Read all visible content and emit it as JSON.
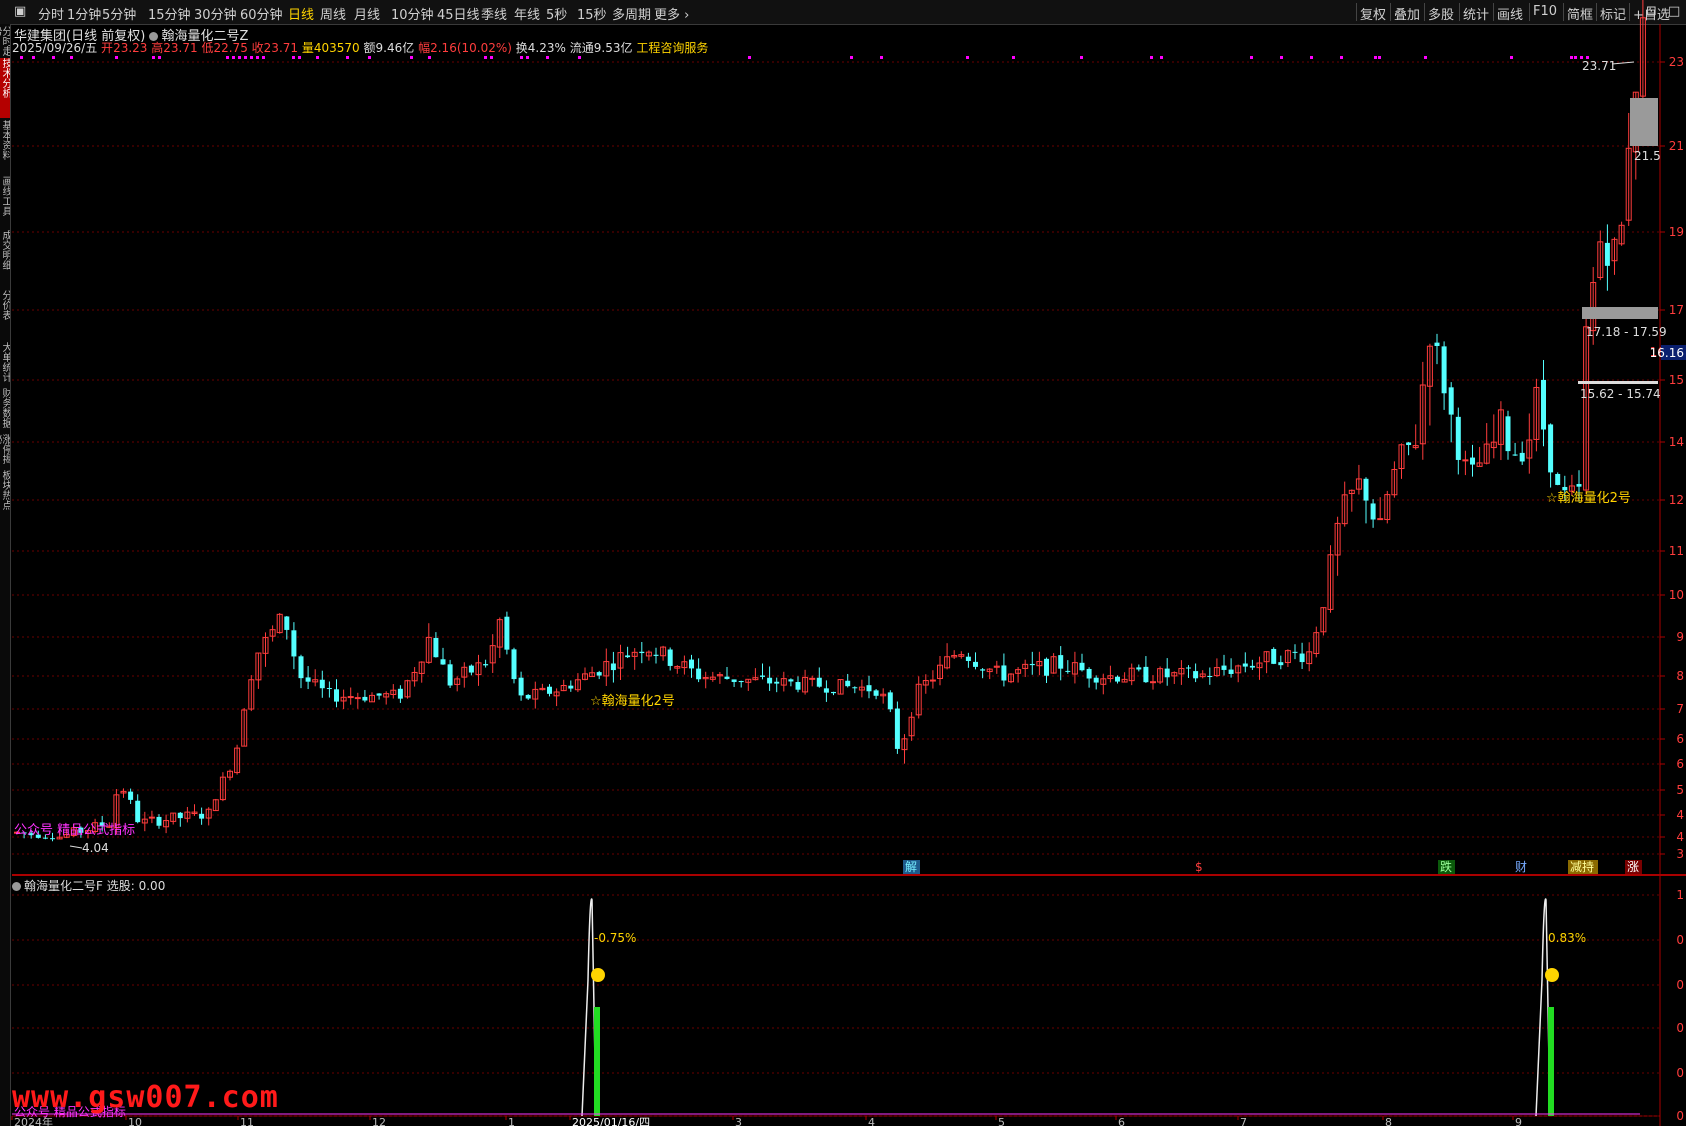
{
  "toolbar": {
    "period_tabs": [
      "分时",
      "1分钟",
      "5分钟",
      "15分钟",
      "30分钟",
      "60分钟",
      "日线",
      "周线",
      "月线",
      "10分钟",
      "45日线",
      "季线",
      "年线",
      "5秒",
      "15秒",
      "多周期",
      "更多"
    ],
    "active_period": "日线",
    "right_buttons": [
      "复权",
      "叠加",
      "多股",
      "统计",
      "画线",
      "F10",
      "简框",
      "标记",
      "+自选"
    ]
  },
  "sidebar": {
    "tabs": [
      "分时走势",
      "技术分析",
      "基本资料",
      "画线工具",
      "成交明细",
      "分价表",
      "大单统计",
      "财务数据",
      "涨停揭秘",
      "板块热点"
    ],
    "active_index": 1
  },
  "header": {
    "stock_name": "华建集团",
    "period_info": "(日线 前复权)",
    "indicator_name": "翰海量化二号Z",
    "date": "2025/09/26/五",
    "open_label": "开",
    "open": "23.23",
    "high_label": "高",
    "high": "23.71",
    "low_label": "低",
    "low": "22.75",
    "close_label": "收",
    "close": "23.71",
    "volume_label": "量",
    "volume": "403570",
    "amount_label": "额",
    "amount": "9.46亿",
    "change_label": "幅",
    "change": "2.16(10.02%)",
    "turnover_label": "换",
    "turnover": "4.23%",
    "float_label": "流通",
    "float": "9.53亿",
    "industry": "工程咨询服务"
  },
  "main_chart": {
    "price_axis": [
      "23",
      "21",
      "19",
      "17",
      "16.16",
      "15",
      "14",
      "12",
      "11",
      "10",
      "9",
      "8",
      "7",
      "6",
      "6",
      "5",
      "4",
      "4",
      "3"
    ],
    "current_price_tag": "16.16",
    "high_marker": "23.71",
    "low_marker": "4.04",
    "box_upper_label": "21.5",
    "box_mid_label": "17.18 - 17.59",
    "box_low_label": "15.62 - 15.74",
    "signal_label_1": "☆翰海量化2号",
    "signal_label_2": "☆翰海量化2号",
    "promo_text": "公众号 精品公式指标",
    "event_markers": [
      "解",
      "$",
      "跌",
      "财",
      "减持",
      "涨"
    ],
    "colors": {
      "up": "#ff3d3d",
      "down": "#54ffff",
      "grid": "#6a0000",
      "dots": "#ff00ff",
      "signal": "#ffd400"
    }
  },
  "sub_chart": {
    "title": "翰海量化二号F",
    "select_label": "选股:",
    "select_value": "0.00",
    "spike_label_1": "-0.75%",
    "spike_label_2": "0.83%",
    "axis": [
      "1",
      "0",
      "0",
      "0",
      "0",
      "0"
    ],
    "promo_text": "公众号 精品公式指标",
    "x_labels": [
      "2024年",
      "10",
      "11",
      "12",
      "1",
      "2025/01/16/四",
      "3",
      "4",
      "5",
      "6",
      "7",
      "8",
      "9"
    ]
  },
  "watermark": "www.gsw007.com"
}
